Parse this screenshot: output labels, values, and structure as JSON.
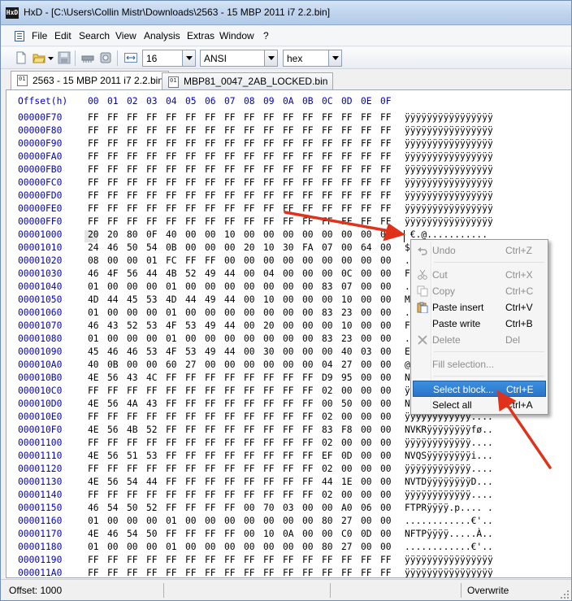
{
  "window": {
    "title": "HxD - [C:\\Users\\Collin Mistr\\Downloads\\2563 - 15 MBP 2011 i7 2.2.bin]",
    "app_icon": "HxD"
  },
  "menu": [
    "File",
    "Edit",
    "Search",
    "View",
    "Analysis",
    "Extras",
    "Window",
    "?"
  ],
  "toolbar": {
    "bytes_per_row": "16",
    "charset": "ANSI",
    "offset_base": "hex"
  },
  "tabs": [
    {
      "label": "2563 - 15 MBP 2011 i7 2.2.bin",
      "active": true
    },
    {
      "label": "MBP81_0047_2AB_LOCKED.bin",
      "active": false
    }
  ],
  "hex": {
    "header_label": "Offset(h)",
    "columns": [
      "00",
      "01",
      "02",
      "03",
      "04",
      "05",
      "06",
      "07",
      "08",
      "09",
      "0A",
      "0B",
      "0C",
      "0D",
      "0E",
      "0F"
    ],
    "rows": [
      {
        "offset": "00000F70",
        "bytes": [
          "FF",
          "FF",
          "FF",
          "FF",
          "FF",
          "FF",
          "FF",
          "FF",
          "FF",
          "FF",
          "FF",
          "FF",
          "FF",
          "FF",
          "FF",
          "FF"
        ],
        "ansi": "ÿÿÿÿÿÿÿÿÿÿÿÿÿÿÿÿ"
      },
      {
        "offset": "00000F80",
        "bytes": [
          "FF",
          "FF",
          "FF",
          "FF",
          "FF",
          "FF",
          "FF",
          "FF",
          "FF",
          "FF",
          "FF",
          "FF",
          "FF",
          "FF",
          "FF",
          "FF"
        ],
        "ansi": "ÿÿÿÿÿÿÿÿÿÿÿÿÿÿÿÿ"
      },
      {
        "offset": "00000F90",
        "bytes": [
          "FF",
          "FF",
          "FF",
          "FF",
          "FF",
          "FF",
          "FF",
          "FF",
          "FF",
          "FF",
          "FF",
          "FF",
          "FF",
          "FF",
          "FF",
          "FF"
        ],
        "ansi": "ÿÿÿÿÿÿÿÿÿÿÿÿÿÿÿÿ"
      },
      {
        "offset": "00000FA0",
        "bytes": [
          "FF",
          "FF",
          "FF",
          "FF",
          "FF",
          "FF",
          "FF",
          "FF",
          "FF",
          "FF",
          "FF",
          "FF",
          "FF",
          "FF",
          "FF",
          "FF"
        ],
        "ansi": "ÿÿÿÿÿÿÿÿÿÿÿÿÿÿÿÿ"
      },
      {
        "offset": "00000FB0",
        "bytes": [
          "FF",
          "FF",
          "FF",
          "FF",
          "FF",
          "FF",
          "FF",
          "FF",
          "FF",
          "FF",
          "FF",
          "FF",
          "FF",
          "FF",
          "FF",
          "FF"
        ],
        "ansi": "ÿÿÿÿÿÿÿÿÿÿÿÿÿÿÿÿ"
      },
      {
        "offset": "00000FC0",
        "bytes": [
          "FF",
          "FF",
          "FF",
          "FF",
          "FF",
          "FF",
          "FF",
          "FF",
          "FF",
          "FF",
          "FF",
          "FF",
          "FF",
          "FF",
          "FF",
          "FF"
        ],
        "ansi": "ÿÿÿÿÿÿÿÿÿÿÿÿÿÿÿÿ"
      },
      {
        "offset": "00000FD0",
        "bytes": [
          "FF",
          "FF",
          "FF",
          "FF",
          "FF",
          "FF",
          "FF",
          "FF",
          "FF",
          "FF",
          "FF",
          "FF",
          "FF",
          "FF",
          "FF",
          "FF"
        ],
        "ansi": "ÿÿÿÿÿÿÿÿÿÿÿÿÿÿÿÿ"
      },
      {
        "offset": "00000FE0",
        "bytes": [
          "FF",
          "FF",
          "FF",
          "FF",
          "FF",
          "FF",
          "FF",
          "FF",
          "FF",
          "FF",
          "FF",
          "FF",
          "FF",
          "FF",
          "FF",
          "FF"
        ],
        "ansi": "ÿÿÿÿÿÿÿÿÿÿÿÿÿÿÿÿ"
      },
      {
        "offset": "00000FF0",
        "bytes": [
          "FF",
          "FF",
          "FF",
          "FF",
          "FF",
          "FF",
          "FF",
          "FF",
          "FF",
          "FF",
          "FF",
          "FF",
          "FF",
          "FF",
          "FF",
          "FF"
        ],
        "ansi": "ÿÿÿÿÿÿÿÿÿÿÿÿÿÿÿÿ"
      },
      {
        "offset": "00001000",
        "bytes": [
          "20",
          "20",
          "80",
          "0F",
          "40",
          "00",
          "00",
          "10",
          "00",
          "00",
          "00",
          "00",
          "00",
          "00",
          "00",
          "00"
        ],
        "ansi": " €.@..........."
      },
      {
        "offset": "00001010",
        "bytes": [
          "24",
          "46",
          "50",
          "54",
          "0B",
          "00",
          "00",
          "00",
          "20",
          "10",
          "30",
          "FA",
          "07",
          "00",
          "64",
          "00"
        ],
        "ansi": "$"
      },
      {
        "offset": "00001020",
        "bytes": [
          "08",
          "00",
          "00",
          "01",
          "FC",
          "FF",
          "FF",
          "00",
          "00",
          "00",
          "00",
          "00",
          "00",
          "00",
          "00",
          "00"
        ],
        "ansi": "."
      },
      {
        "offset": "00001030",
        "bytes": [
          "46",
          "4F",
          "56",
          "44",
          "4B",
          "52",
          "49",
          "44",
          "00",
          "04",
          "00",
          "00",
          "00",
          "0C",
          "00",
          "00"
        ],
        "ansi": "F"
      },
      {
        "offset": "00001040",
        "bytes": [
          "01",
          "00",
          "00",
          "00",
          "01",
          "00",
          "00",
          "00",
          "00",
          "00",
          "00",
          "00",
          "83",
          "07",
          "00",
          "00"
        ],
        "ansi": "."
      },
      {
        "offset": "00001050",
        "bytes": [
          "4D",
          "44",
          "45",
          "53",
          "4D",
          "44",
          "49",
          "44",
          "00",
          "10",
          "00",
          "00",
          "00",
          "10",
          "00",
          "00"
        ],
        "ansi": "M"
      },
      {
        "offset": "00001060",
        "bytes": [
          "01",
          "00",
          "00",
          "00",
          "01",
          "00",
          "00",
          "00",
          "00",
          "00",
          "00",
          "00",
          "83",
          "23",
          "00",
          "00"
        ],
        "ansi": "."
      },
      {
        "offset": "00001070",
        "bytes": [
          "46",
          "43",
          "52",
          "53",
          "4F",
          "53",
          "49",
          "44",
          "00",
          "20",
          "00",
          "00",
          "00",
          "10",
          "00",
          "00"
        ],
        "ansi": "F"
      },
      {
        "offset": "00001080",
        "bytes": [
          "01",
          "00",
          "00",
          "00",
          "01",
          "00",
          "00",
          "00",
          "00",
          "00",
          "00",
          "00",
          "83",
          "23",
          "00",
          "00"
        ],
        "ansi": "."
      },
      {
        "offset": "00001090",
        "bytes": [
          "45",
          "46",
          "46",
          "53",
          "4F",
          "53",
          "49",
          "44",
          "00",
          "30",
          "00",
          "00",
          "00",
          "40",
          "03",
          "00"
        ],
        "ansi": "E"
      },
      {
        "offset": "000010A0",
        "bytes": [
          "40",
          "0B",
          "00",
          "00",
          "60",
          "27",
          "00",
          "00",
          "00",
          "00",
          "00",
          "00",
          "04",
          "27",
          "00",
          "00"
        ],
        "ansi": "@"
      },
      {
        "offset": "000010B0",
        "bytes": [
          "4E",
          "56",
          "43",
          "4C",
          "FF",
          "FF",
          "FF",
          "FF",
          "FF",
          "FF",
          "FF",
          "FF",
          "D9",
          "95",
          "00",
          "00"
        ],
        "ansi": "N"
      },
      {
        "offset": "000010C0",
        "bytes": [
          "FF",
          "FF",
          "FF",
          "FF",
          "FF",
          "FF",
          "FF",
          "FF",
          "FF",
          "FF",
          "FF",
          "FF",
          "02",
          "00",
          "00",
          "00"
        ],
        "ansi": "ÿ"
      },
      {
        "offset": "000010D0",
        "bytes": [
          "4E",
          "56",
          "4A",
          "43",
          "FF",
          "FF",
          "FF",
          "FF",
          "FF",
          "FF",
          "FF",
          "FF",
          "00",
          "50",
          "00",
          "00"
        ],
        "ansi": "N"
      },
      {
        "offset": "000010E0",
        "bytes": [
          "FF",
          "FF",
          "FF",
          "FF",
          "FF",
          "FF",
          "FF",
          "FF",
          "FF",
          "FF",
          "FF",
          "FF",
          "02",
          "00",
          "00",
          "00"
        ],
        "ansi": "ÿÿÿÿÿÿÿÿÿÿÿÿ...."
      },
      {
        "offset": "000010F0",
        "bytes": [
          "4E",
          "56",
          "4B",
          "52",
          "FF",
          "FF",
          "FF",
          "FF",
          "FF",
          "FF",
          "FF",
          "FF",
          "83",
          "F8",
          "00",
          "00"
        ],
        "ansi": "NVKRÿÿÿÿÿÿÿÿfø.."
      },
      {
        "offset": "00001100",
        "bytes": [
          "FF",
          "FF",
          "FF",
          "FF",
          "FF",
          "FF",
          "FF",
          "FF",
          "FF",
          "FF",
          "FF",
          "FF",
          "02",
          "00",
          "00",
          "00"
        ],
        "ansi": "ÿÿÿÿÿÿÿÿÿÿÿÿ...."
      },
      {
        "offset": "00001110",
        "bytes": [
          "4E",
          "56",
          "51",
          "53",
          "FF",
          "FF",
          "FF",
          "FF",
          "FF",
          "FF",
          "FF",
          "FF",
          "EF",
          "0D",
          "00",
          "00"
        ],
        "ansi": "NVQSÿÿÿÿÿÿÿÿi..."
      },
      {
        "offset": "00001120",
        "bytes": [
          "FF",
          "FF",
          "FF",
          "FF",
          "FF",
          "FF",
          "FF",
          "FF",
          "FF",
          "FF",
          "FF",
          "FF",
          "02",
          "00",
          "00",
          "00"
        ],
        "ansi": "ÿÿÿÿÿÿÿÿÿÿÿÿ...."
      },
      {
        "offset": "00001130",
        "bytes": [
          "4E",
          "56",
          "54",
          "44",
          "FF",
          "FF",
          "FF",
          "FF",
          "FF",
          "FF",
          "FF",
          "FF",
          "44",
          "1E",
          "00",
          "00"
        ],
        "ansi": "NVTDÿÿÿÿÿÿÿÿD..."
      },
      {
        "offset": "00001140",
        "bytes": [
          "FF",
          "FF",
          "FF",
          "FF",
          "FF",
          "FF",
          "FF",
          "FF",
          "FF",
          "FF",
          "FF",
          "FF",
          "02",
          "00",
          "00",
          "00"
        ],
        "ansi": "ÿÿÿÿÿÿÿÿÿÿÿÿ...."
      },
      {
        "offset": "00001150",
        "bytes": [
          "46",
          "54",
          "50",
          "52",
          "FF",
          "FF",
          "FF",
          "FF",
          "00",
          "70",
          "03",
          "00",
          "00",
          "A0",
          "06",
          "00"
        ],
        "ansi": "FTPRÿÿÿÿ.p.... ."
      },
      {
        "offset": "00001160",
        "bytes": [
          "01",
          "00",
          "00",
          "00",
          "01",
          "00",
          "00",
          "00",
          "00",
          "00",
          "00",
          "00",
          "80",
          "27",
          "00",
          "00"
        ],
        "ansi": "............€'.."
      },
      {
        "offset": "00001170",
        "bytes": [
          "4E",
          "46",
          "54",
          "50",
          "FF",
          "FF",
          "FF",
          "FF",
          "00",
          "10",
          "0A",
          "00",
          "00",
          "C0",
          "0D",
          "00"
        ],
        "ansi": "NFTPÿÿÿÿ.....À.."
      },
      {
        "offset": "00001180",
        "bytes": [
          "01",
          "00",
          "00",
          "00",
          "01",
          "00",
          "00",
          "00",
          "00",
          "00",
          "00",
          "00",
          "80",
          "27",
          "00",
          "00"
        ],
        "ansi": "............€'.."
      },
      {
        "offset": "00001190",
        "bytes": [
          "FF",
          "FF",
          "FF",
          "FF",
          "FF",
          "FF",
          "FF",
          "FF",
          "FF",
          "FF",
          "FF",
          "FF",
          "FF",
          "FF",
          "FF",
          "FF"
        ],
        "ansi": "ÿÿÿÿÿÿÿÿÿÿÿÿÿÿÿÿ"
      },
      {
        "offset": "000011A0",
        "bytes": [
          "FF",
          "FF",
          "FF",
          "FF",
          "FF",
          "FF",
          "FF",
          "FF",
          "FF",
          "FF",
          "FF",
          "FF",
          "FF",
          "FF",
          "FF",
          "FF"
        ],
        "ansi": "ÿÿÿÿÿÿÿÿÿÿÿÿÿÿÿÿ"
      }
    ]
  },
  "context_menu": {
    "items": [
      {
        "label": "Undo",
        "shortcut": "Ctrl+Z",
        "enabled": false,
        "icon": "undo-icon"
      },
      {
        "separator": true
      },
      {
        "label": "Cut",
        "shortcut": "Ctrl+X",
        "enabled": false,
        "icon": "scissors-icon"
      },
      {
        "label": "Copy",
        "shortcut": "Ctrl+C",
        "enabled": false,
        "icon": "copy-icon"
      },
      {
        "label": "Paste insert",
        "shortcut": "Ctrl+V",
        "enabled": true,
        "icon": "paste-icon"
      },
      {
        "label": "Paste write",
        "shortcut": "Ctrl+B",
        "enabled": true,
        "icon": ""
      },
      {
        "label": "Delete",
        "shortcut": "Del",
        "enabled": false,
        "icon": "delete-x-icon"
      },
      {
        "separator": true
      },
      {
        "label": "Fill selection...",
        "shortcut": "",
        "enabled": false,
        "icon": ""
      },
      {
        "separator": true
      },
      {
        "label": "Select block...",
        "shortcut": "Ctrl+E",
        "enabled": true,
        "highlighted": true,
        "icon": ""
      },
      {
        "label": "Select all",
        "shortcut": "Ctrl+A",
        "enabled": true,
        "icon": ""
      }
    ]
  },
  "status": {
    "offset": "Offset: 1000",
    "mode": "Overwrite"
  },
  "colors": {
    "offset_blue": "#0000d0",
    "highlight": "#3b8fe0",
    "arrow_red": "#e0311a"
  }
}
